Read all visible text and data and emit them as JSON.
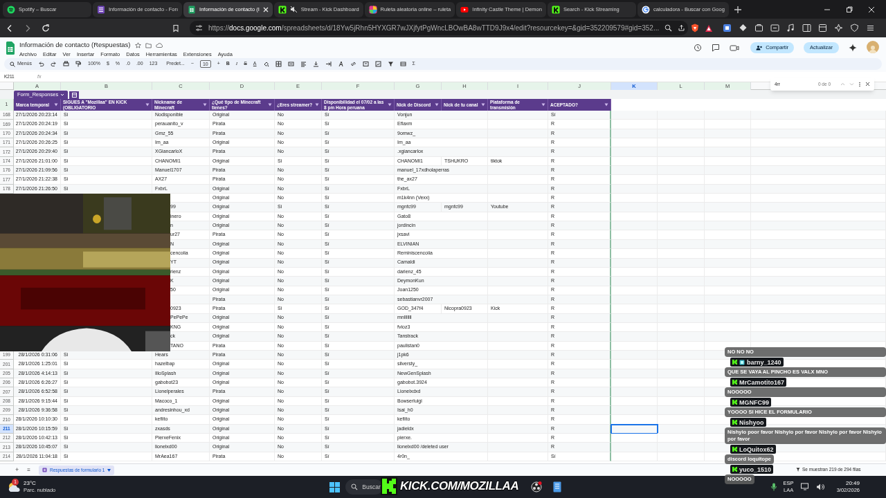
{
  "browser": {
    "tabs": [
      {
        "title": "Spotify – Buscar",
        "kind": "spotify",
        "selected": false,
        "muted": false
      },
      {
        "title": "Información de contacto - Forı",
        "kind": "forms",
        "selected": false,
        "muted": false
      },
      {
        "title": "Información de contacto (I",
        "kind": "sheets",
        "selected": true,
        "muted": false
      },
      {
        "title": "Stream - Kick Dashboard",
        "kind": "kick",
        "selected": false,
        "muted": true
      },
      {
        "title": "Ruleta aleatoria online – ruleta",
        "kind": "wheel",
        "selected": false,
        "muted": false
      },
      {
        "title": "Infinity Castle Theme | Demon",
        "kind": "youtube",
        "selected": false,
        "muted": false
      },
      {
        "title": "Search - Kick Streaming",
        "kind": "kick",
        "selected": false,
        "muted": false
      },
      {
        "title": "calculadora - Buscar con Goog",
        "kind": "google",
        "selected": false,
        "muted": false
      }
    ],
    "url_prefix": "https://",
    "url_host": "docs.google.com",
    "url_rest": "/spreadsheets/d/18Yw5jRhn5HYXGR7wJXjfytPgWncLBOwBA8wTTD9J9x4/edit?resourcekey=&gid=352209579#gid=352..."
  },
  "sheets": {
    "title": "Información de contacto (Respuestas)",
    "menu": [
      "Archivo",
      "Editar",
      "Ver",
      "Insertar",
      "Formato",
      "Datos",
      "Herramientas",
      "Extensiones",
      "Ayuda"
    ],
    "share_button": "Compartir",
    "update_button": "Actualizar",
    "toolbar": {
      "menus": "Menús",
      "zoom": "100%",
      "currency": "$",
      "percent": "%",
      "dec_less": ".0",
      "dec_more": ".00",
      "number_format": "123",
      "font": "Predet...",
      "minus": "−",
      "font_size": "10",
      "plus": "+",
      "bold": "B",
      "italic": "I",
      "strike": "S",
      "text_color": "A",
      "sum": "Σ"
    },
    "name_box": "K211",
    "fx": "fx",
    "find": {
      "value": "4rr",
      "count": "0 de 0"
    },
    "filter_view": "Form_Responses",
    "columns": [
      {
        "letter": "A",
        "header": "Marca temporal",
        "selected": false
      },
      {
        "letter": "B",
        "header": "SIGUES A \"Mozillaa\" EN KICK (OBLIGATORIO",
        "selected": false
      },
      {
        "letter": "C",
        "header": "Nickname de Minecraft",
        "selected": false
      },
      {
        "letter": "D",
        "header": "¿Qué tipo de Minecraft tienes?",
        "selected": false
      },
      {
        "letter": "E",
        "header": "¿Eres streamer?",
        "selected": false
      },
      {
        "letter": "F",
        "header": "Disponibilidad el 07/02 a las 8 pm Hora peruana",
        "selected": false
      },
      {
        "letter": "G",
        "header": "Nick de Discord",
        "selected": false
      },
      {
        "letter": "H",
        "header": "Nick de tu canal",
        "selected": false
      },
      {
        "letter": "I",
        "header": "Plataforma de transmisión",
        "selected": false
      },
      {
        "letter": "J",
        "header": "ACEPTADO?",
        "selected": false
      },
      {
        "letter": "K",
        "selected": true
      },
      {
        "letter": "L",
        "selected": false
      },
      {
        "letter": "M",
        "selected": false
      }
    ],
    "header_row_number": "1",
    "rows": [
      {
        "number": "168",
        "selected": false,
        "covered": false,
        "cells": [
          "27/1/2026 20:23:14",
          "Si",
          "Nodisponible",
          "Original",
          "No",
          "Sí",
          "Vonjun",
          null,
          null,
          "Sí"
        ]
      },
      {
        "number": "169",
        "selected": false,
        "covered": false,
        "cells": [
          "27/1/2026 20:24:19",
          "Si",
          "perauanito_v",
          "Pirata",
          "No",
          "Sí",
          "Eflaxm",
          null,
          null,
          "R"
        ]
      },
      {
        "number": "170",
        "selected": false,
        "covered": false,
        "cells": [
          "27/1/2026 20:24:34",
          "Si",
          "Gmz_55",
          "Pirata",
          "No",
          "Sí",
          "9omwz_",
          null,
          null,
          "R"
        ]
      },
      {
        "number": "171",
        "selected": false,
        "covered": false,
        "cells": [
          "27/1/2026 20:26:25",
          "Si",
          "Im_aa",
          "Original",
          "No",
          "Sí",
          "Im_aa",
          null,
          null,
          "R"
        ]
      },
      {
        "number": "172",
        "selected": false,
        "covered": false,
        "cells": [
          "27/1/2026 20:29:40",
          "Si",
          "XGiancarloX",
          "Pirata",
          "No",
          "Sí",
          ".xgiancarlox",
          null,
          null,
          "R"
        ]
      },
      {
        "number": "174",
        "selected": false,
        "covered": false,
        "cells": [
          "27/1/2026 21:01:00",
          "Si",
          "CHANOMI1",
          "Original",
          "Si",
          "Sí",
          "CHANOMI1",
          "TSHUKRO",
          "tiktok",
          "R"
        ]
      },
      {
        "number": "176",
        "selected": false,
        "covered": false,
        "cells": [
          "27/1/2026 21:09:56",
          "Si",
          "Manuel1707",
          "Pirata",
          "No",
          "Sí",
          "manuel_17xdholaperras",
          null,
          null,
          "R"
        ]
      },
      {
        "number": "177",
        "selected": false,
        "covered": false,
        "cells": [
          "27/1/2026 21:22:38",
          "Si",
          "AX27",
          "Pirata",
          "No",
          "Sí",
          "the_ax27",
          null,
          null,
          "R"
        ]
      },
      {
        "number": "178",
        "selected": false,
        "covered": false,
        "cells": [
          "27/1/2026 21:26:50",
          "Si",
          "FxbrL",
          "Original",
          "No",
          "Sí",
          "FxbrL",
          null,
          null,
          "R"
        ]
      },
      {
        "covered": true,
        "cells": [
          null,
          "Original",
          "No",
          "Sí",
          "m1k4nn (Vexx)",
          null,
          null,
          "R"
        ]
      },
      {
        "covered": true,
        "cells": [
          "99",
          "Original",
          "Si",
          "Sí",
          "mgnfc99",
          "mgnfc99",
          "Youtube",
          "R"
        ]
      },
      {
        "covered": true,
        "cells": [
          "inero",
          "Original",
          "No",
          "Sí",
          "Gato8",
          null,
          null,
          "R"
        ]
      },
      {
        "covered": true,
        "cells": [
          "n",
          "Original",
          "No",
          "Sí",
          "jordincin",
          null,
          null,
          "R"
        ]
      },
      {
        "covered": true,
        "cells": [
          "ur27",
          "Pirata",
          "No",
          "Sí",
          "jxsavi",
          null,
          null,
          "R"
        ]
      },
      {
        "covered": true,
        "cells": [
          "N",
          "Original",
          "No",
          "Sí",
          "ELVINIAN",
          null,
          null,
          "R"
        ]
      },
      {
        "covered": true,
        "cells": [
          "cencoiia",
          "Original",
          "No",
          "Sí",
          "Reminiscencoiia",
          null,
          null,
          "R"
        ]
      },
      {
        "covered": true,
        "cells": [
          "YT",
          "Original",
          "No",
          "Sí",
          "Camaldi",
          null,
          null,
          "R"
        ]
      },
      {
        "covered": true,
        "cells": [
          "rienz",
          "Original",
          "No",
          "Sí",
          "darienz_45",
          null,
          null,
          "R"
        ]
      },
      {
        "covered": true,
        "cells": [
          "K",
          "Original",
          "No",
          "Sí",
          "DeymonKun",
          null,
          null,
          "R"
        ]
      },
      {
        "covered": true,
        "cells": [
          "50",
          "Original",
          "No",
          "Sí",
          "Joan1250",
          null,
          null,
          "R"
        ]
      },
      {
        "covered": true,
        "cells": [
          null,
          "Pirata",
          "No",
          "Sí",
          "sebastianvr2007",
          null,
          null,
          "R"
        ]
      },
      {
        "covered": true,
        "cells": [
          "0923",
          "Pirata",
          "Si",
          "Sí",
          "GOD_347f4",
          "Nicopra0923",
          "Kick",
          "R"
        ]
      },
      {
        "covered": true,
        "cells": [
          "PePePe",
          "Original",
          "No",
          "Sí",
          "mnlllllll",
          null,
          null,
          "R"
        ]
      },
      {
        "covered": true,
        "cells": [
          "KNG",
          "Original",
          "No",
          "Sí",
          "fvioz3",
          null,
          null,
          "R"
        ]
      },
      {
        "covered": true,
        "cells": [
          "ck",
          "Original",
          "No",
          "Sí",
          "Tanstrack",
          null,
          null,
          "R"
        ]
      },
      {
        "covered": true,
        "cells": [
          "TANO",
          "Pirata",
          "No",
          "Sí",
          "paulistan0",
          null,
          null,
          "R"
        ]
      },
      {
        "number": "199",
        "selected": false,
        "covered": false,
        "cells": [
          "28/1/2026 0:31:06",
          "Si",
          "Hears",
          "Pirata",
          "No",
          "Sí",
          "j1pk6",
          null,
          null,
          "R"
        ]
      },
      {
        "number": "201",
        "selected": false,
        "covered": false,
        "cells": [
          "28/1/2026 1:25:01",
          "Si",
          "hazelbap",
          "Original",
          "No",
          "Sí",
          "silversty_",
          null,
          null,
          "R"
        ]
      },
      {
        "number": "205",
        "selected": false,
        "covered": false,
        "cells": [
          "28/1/2026 4:14:13",
          "Si",
          "IlloSplash",
          "Original",
          "No",
          "Sí",
          "NewGenSplash",
          null,
          null,
          "R"
        ]
      },
      {
        "number": "206",
        "selected": false,
        "covered": false,
        "cells": [
          "28/1/2026 6:26:27",
          "Si",
          "gabobot23",
          "Original",
          "No",
          "Sí",
          "gabobot.3924",
          null,
          null,
          "R"
        ]
      },
      {
        "number": "207",
        "selected": false,
        "covered": false,
        "cells": [
          "28/1/2026 6:52:58",
          "Si",
          "Lionelperales",
          "Pirata",
          "No",
          "Sí",
          "Lionelxdxd",
          null,
          null,
          "R"
        ]
      },
      {
        "number": "208",
        "selected": false,
        "covered": false,
        "cells": [
          "28/1/2026 9:15:44",
          "Si",
          "Macoco_1",
          "Original",
          "No",
          "Sí",
          "Bowserluigi",
          null,
          null,
          "R"
        ]
      },
      {
        "number": "209",
        "selected": false,
        "covered": false,
        "cells": [
          "28/1/2026 9:36:58",
          "Si",
          "andresinhou_xd",
          "Original",
          "No",
          "Sí",
          "Isai_h0",
          null,
          null,
          "R"
        ]
      },
      {
        "number": "210",
        "selected": false,
        "covered": false,
        "cells": [
          "28/1/2026 10:10:30",
          "Si",
          "kefiito",
          "Original",
          "No",
          "Sí",
          "kefiito",
          null,
          null,
          "R"
        ]
      },
      {
        "number": "211",
        "selected": true,
        "covered": false,
        "cells": [
          "28/1/2026 10:15:59",
          "Si",
          "zxasds",
          "Original",
          "No",
          "Sí",
          "jadieldx",
          null,
          null,
          "R"
        ]
      },
      {
        "number": "212",
        "selected": false,
        "covered": false,
        "cells": [
          "28/1/2026 10:42:13",
          "Si",
          "PierxeFenix",
          "Original",
          "No",
          "Sí",
          "pierxe.",
          null,
          null,
          "R"
        ]
      },
      {
        "number": "213",
        "selected": false,
        "covered": false,
        "cells": [
          "28/1/2026 10:45:07",
          "Si",
          "lionelxd00",
          "Original",
          "No",
          "Sí",
          "lionelxd00 /deleted user",
          null,
          null,
          "R"
        ]
      },
      {
        "number": "214",
        "selected": false,
        "covered": false,
        "cells": [
          "28/1/2026 11:04:18",
          "Si",
          "MrAea167",
          "Pirata",
          "No",
          "Sí",
          "4r0n_",
          null,
          null,
          "Sí"
        ]
      }
    ],
    "add_sheet": "+",
    "all_sheets": "≡",
    "sheet_tab": "Respuestas de formulario 1",
    "row_count": "Se muestran 219 de 294 filas"
  },
  "chat": [
    {
      "message": "NO NO NO"
    },
    {
      "user": "barny_1240",
      "badge": true,
      "message": "QUE SE VAYA AL PINCHO ES VALX MNO"
    },
    {
      "user": "MrCamotito167",
      "badge": false,
      "message": "NOOOOO"
    },
    {
      "user": "MGNFC99",
      "badge": false,
      "message": "YOOOO SI HICE EL FORMULARIO"
    },
    {
      "user": "Nishyoo",
      "badge": false,
      "message": "Nishyio poor favor Nishyio por favor Nishyio por favor Nishyio por favor"
    },
    {
      "user": "LoQuitox62",
      "badge": false,
      "message": "discord loquitope"
    },
    {
      "user": "yuco_1510",
      "badge": false,
      "message": "NOOOOO"
    }
  ],
  "stream_overlay": "KICK.COM/MOZILLAA",
  "taskbar": {
    "weather_badge": "1",
    "temperature": "23°C",
    "condition": "Parc. nublado",
    "search": "Buscar",
    "language": "ESP",
    "layout": "LAA",
    "time": "20:49",
    "date": "3/02/2026"
  }
}
